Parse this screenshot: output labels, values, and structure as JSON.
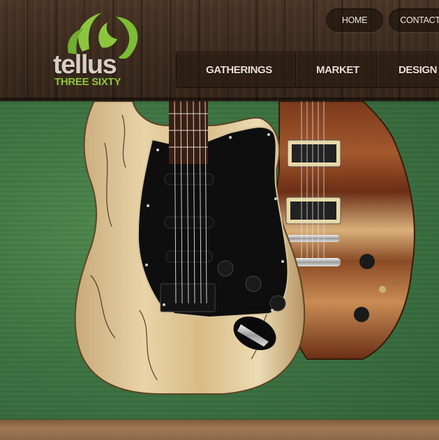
{
  "brand": {
    "name": "tellus",
    "subtitle": "THREE SIXTY",
    "accent_color": "#8cc63f"
  },
  "utility_nav": {
    "home": "HOME",
    "contact": "CONTACT"
  },
  "main_nav": {
    "items": [
      "GATHERINGS",
      "MARKET",
      "DESIGN &"
    ]
  },
  "hero": {
    "subject": "electric-guitars-on-green-wall"
  }
}
